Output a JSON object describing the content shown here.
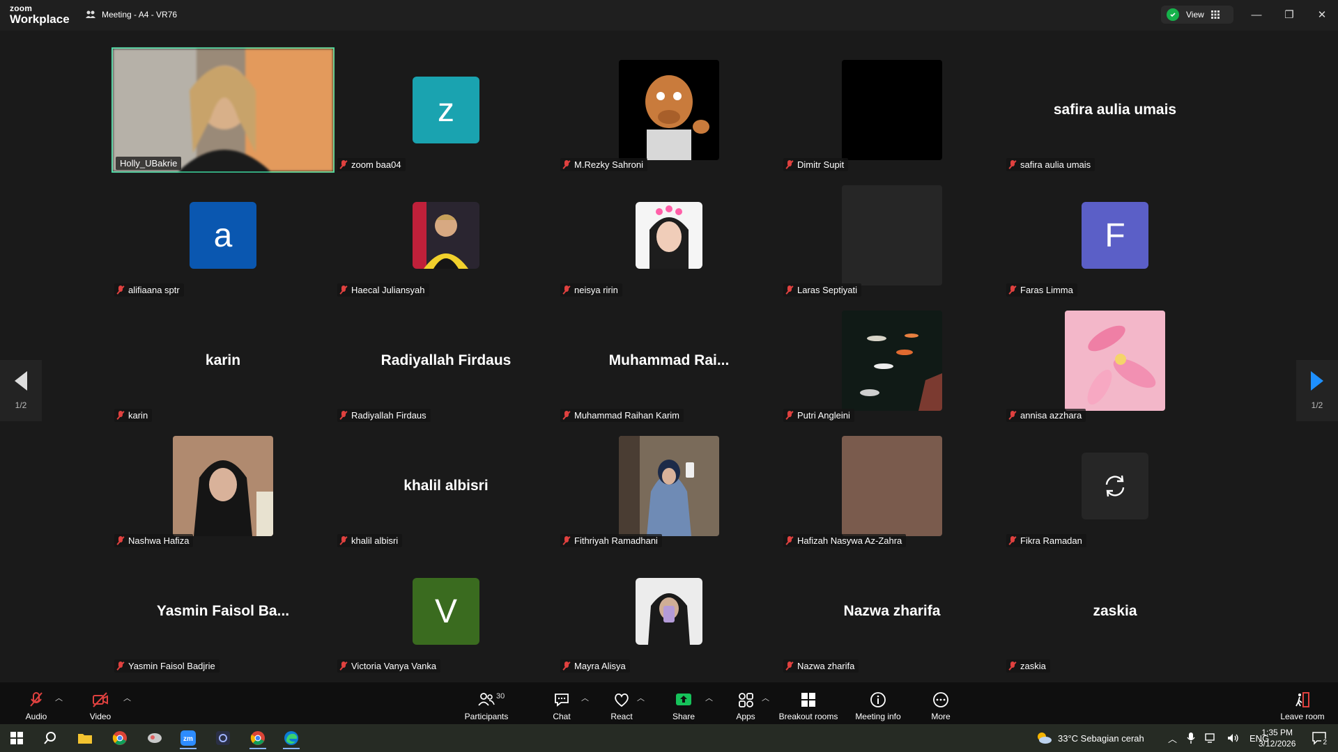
{
  "window": {
    "brand_line1": "zoom",
    "brand_line2": "Workplace",
    "meeting_title": "Meeting - A4 - VR76",
    "view_label": "View"
  },
  "participants": [
    {
      "name": "Holly_UBakrie",
      "kind": "video",
      "muted": false,
      "active": true
    },
    {
      "name": "zoom baa04",
      "kind": "letter",
      "letter": "z",
      "color": "#1aa3b0"
    },
    {
      "name": "M.Rezky Sahroni",
      "kind": "image",
      "art": "cartoon"
    },
    {
      "name": "Dimitr Supit",
      "kind": "image",
      "art": "black"
    },
    {
      "name": "safira aulia umais",
      "kind": "text",
      "display": "safira aulia umais"
    },
    {
      "name": "alifiaana sptr",
      "kind": "letter",
      "letter": "a",
      "color": "#0a57b0"
    },
    {
      "name": "Haecal Juliansyah",
      "kind": "image-small",
      "art": "person-yellow"
    },
    {
      "name": "neisya ririn",
      "kind": "image-small",
      "art": "person-pink"
    },
    {
      "name": "Laras Septiyati",
      "kind": "image",
      "art": "dark"
    },
    {
      "name": "Faras Limma",
      "kind": "letter",
      "letter": "F",
      "color": "#5b5fc7"
    },
    {
      "name": "karin",
      "kind": "text",
      "display": "karin"
    },
    {
      "name": "Radiyallah Firdaus",
      "kind": "text",
      "display": "Radiyallah Firdaus"
    },
    {
      "name": "Muhammad Raihan Karim",
      "kind": "text",
      "display": "Muhammad  Rai..."
    },
    {
      "name": "Putri Angleini",
      "kind": "image",
      "art": "koi"
    },
    {
      "name": "annisa azzhara",
      "kind": "image",
      "art": "flower"
    },
    {
      "name": "Nashwa Hafiza",
      "kind": "image",
      "art": "person-hijab"
    },
    {
      "name": "khalil albisri",
      "kind": "text",
      "display": "khalil albisri"
    },
    {
      "name": "Fithriyah Ramadhani",
      "kind": "image",
      "art": "person-mirror"
    },
    {
      "name": "Hafizah Nasywa Az-Zahra",
      "kind": "image",
      "art": "brown"
    },
    {
      "name": "Fikra Ramadan",
      "kind": "reload"
    },
    {
      "name": "Yasmin Faisol Badjrie",
      "kind": "text",
      "display": "Yasmin  Faisol  Ba..."
    },
    {
      "name": "Victoria Vanya Vanka",
      "kind": "letter",
      "letter": "V",
      "color": "#3a6b1f"
    },
    {
      "name": "Mayra Alisya",
      "kind": "image-small",
      "art": "person-phone"
    },
    {
      "name": "Nazwa zharifa",
      "kind": "text",
      "display": "Nazwa zharifa"
    },
    {
      "name": "zaskia",
      "kind": "text",
      "display": "zaskia"
    }
  ],
  "pager": {
    "left_label": "1/2",
    "right_label": "1/2"
  },
  "toolbar": {
    "audio": "Audio",
    "video": "Video",
    "participants": "Participants",
    "participants_count": "30",
    "chat": "Chat",
    "react": "React",
    "share": "Share",
    "apps": "Apps",
    "breakout": "Breakout rooms",
    "meeting_info": "Meeting info",
    "more": "More",
    "leave": "Leave room"
  },
  "taskbar": {
    "weather": "33°C  Sebagian cerah",
    "lang": "ENG",
    "time": "1:35 PM",
    "date": "3/12/2026",
    "notif_count": "2"
  },
  "colors": {
    "active_border": "#3ee0a5",
    "share_green": "#16c25a",
    "muted_red": "#e0413f"
  }
}
